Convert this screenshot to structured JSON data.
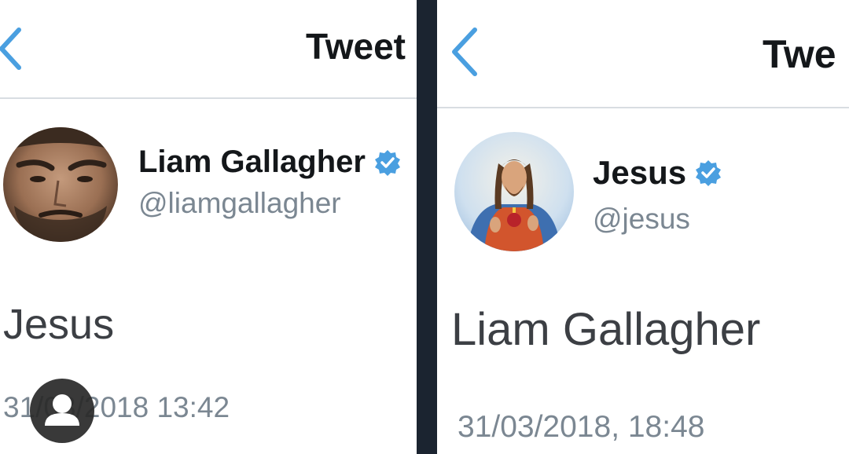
{
  "colors": {
    "accent": "#4a9fe0",
    "text_primary": "#14171a",
    "text_secondary": "#7b8792",
    "divider": "#1b2430"
  },
  "left_tweet": {
    "header_title": "Tweet",
    "back_icon": "chevron-left-icon",
    "display_name": "Liam Gallagher",
    "verified_icon": "verified-badge-icon",
    "handle": "@liamgallagher",
    "text": "Jesus",
    "timestamp": "31/03/2018 13:42"
  },
  "right_tweet": {
    "header_title": "Twe",
    "back_icon": "chevron-left-icon",
    "display_name": "Jesus",
    "verified_icon": "verified-badge-icon",
    "handle": "@jesus",
    "text": "Liam Gallagher",
    "timestamp": "31/03/2018, 18:48"
  },
  "overlay": {
    "icon": "user-profile-icon"
  }
}
